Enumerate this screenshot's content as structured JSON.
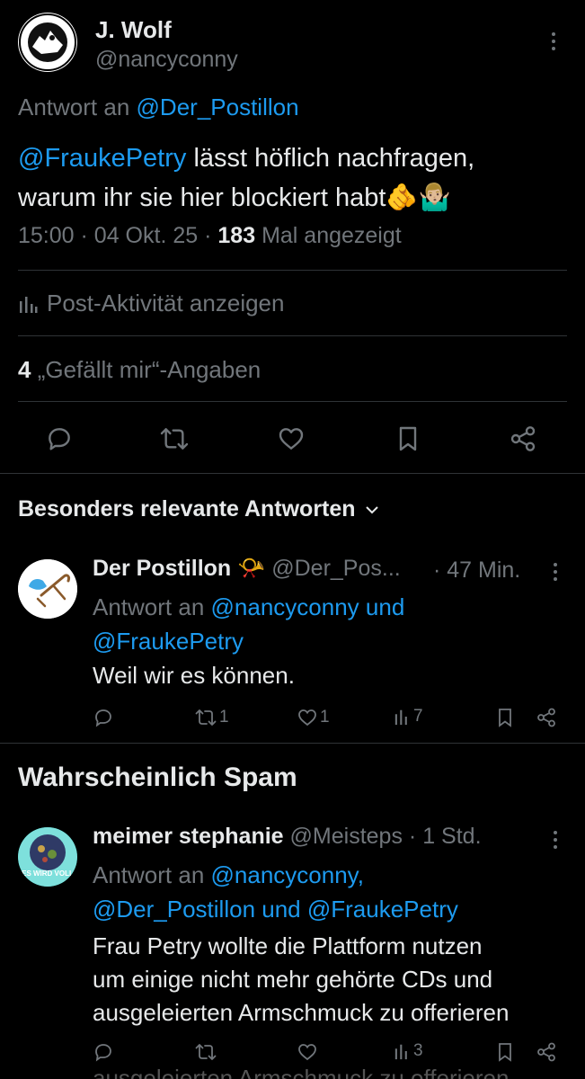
{
  "main_post": {
    "author_name": "J. Wolf",
    "author_handle": "@nancyconny",
    "reply_prefix": "Antwort an",
    "reply_to": "@Der_Postillon",
    "text_mention": "@FraukePetry",
    "text_line1": " lässt höflich nachfragen,",
    "text_line2": "warum ihr sie hier blockiert habt",
    "emojis": "🫵🤷🏼‍♂️",
    "time": "15:00",
    "date": "04 Okt. 25",
    "views_count": "183",
    "views_label": "Mal angezeigt",
    "activity_label": "Post-Aktivität anzeigen",
    "likes_count": "4",
    "likes_label": "„Gefällt mir“-Angaben"
  },
  "replies_header": "Besonders relevante Antworten",
  "reply1": {
    "author_name": "Der Postillon",
    "emoji": "📯",
    "author_handle": "@Der_Pos...",
    "time": "· 47 Min.",
    "reply_prefix": "Antwort an",
    "reply_to_line1": "@nancyconny und",
    "reply_to_line2": "@FraukePetry",
    "text": "Weil wir es können.",
    "retweets": "1",
    "likes": "1",
    "views": "7"
  },
  "spam_header": "Wahrscheinlich Spam",
  "reply2": {
    "author_name": "meimer stephanie",
    "author_handle": "@Meisteps",
    "time": "· 1 Std.",
    "reply_prefix": "Antwort an",
    "reply_to_line1": "@nancyconny,",
    "reply_to_line2": "@Der_Postillon und @FraukePetry",
    "text_line1": "Frau Petry wollte die Plattform nutzen",
    "text_line2": "um einige  nicht mehr gehörte CDs und",
    "text_line3": "ausgeleierten Armschmuck zu offerieren",
    "views": "3",
    "avatar_text": "ES WIRD VOLL",
    "overflow_text": "ausgeleierten Armschmuck zu offerieren"
  },
  "colors": {
    "background": "#000000",
    "text": "#e7e9ea",
    "muted": "#71767b",
    "link": "#1d9bf0",
    "divider": "#2f3336"
  },
  "icons": [
    "more-icon",
    "reply-icon",
    "retweet-icon",
    "like-icon",
    "bookmark-icon",
    "share-icon",
    "analytics-icon",
    "chevron-down-icon"
  ]
}
